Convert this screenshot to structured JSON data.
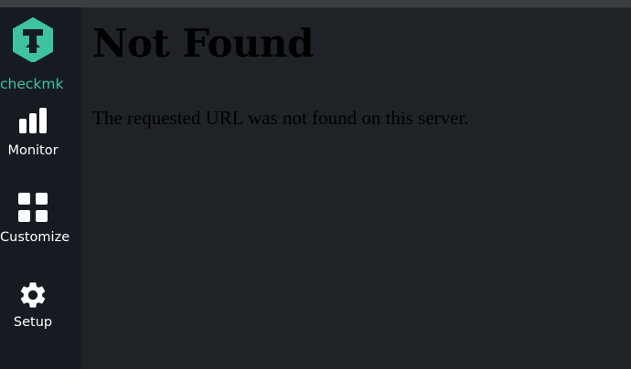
{
  "logo": {
    "text": "checkmk",
    "icon": "checkmk-logo-icon",
    "color": "#3fc2a0"
  },
  "sidebar": {
    "items": [
      {
        "label": "Monitor",
        "icon": "bar-chart-icon"
      },
      {
        "label": "Customize",
        "icon": "grid-icon"
      },
      {
        "label": "Setup",
        "icon": "gear-icon"
      }
    ]
  },
  "main": {
    "title": "Not Found",
    "message": "The requested URL was not found on this server."
  },
  "colors": {
    "sidebar_bg": "#161b22",
    "main_bg": "#1f2327",
    "accent": "#3fc2a0",
    "text": "#000000"
  }
}
